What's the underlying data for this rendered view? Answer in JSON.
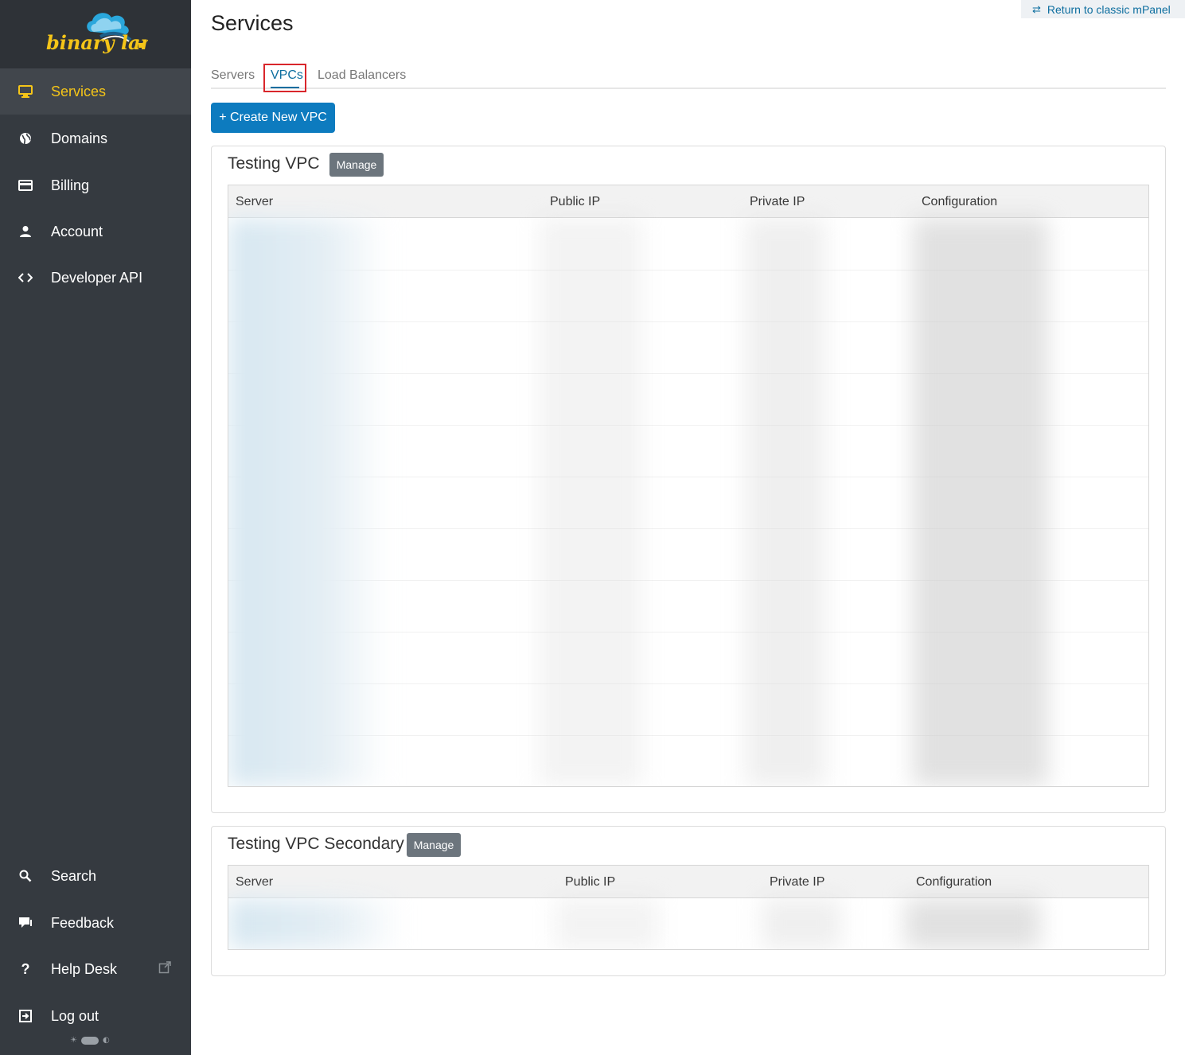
{
  "brand": {
    "logo_text": "binary lane"
  },
  "sidebar": {
    "nav": [
      {
        "label": "Services",
        "icon": "monitor-icon",
        "active": true
      },
      {
        "label": "Domains",
        "icon": "globe-icon",
        "active": false
      },
      {
        "label": "Billing",
        "icon": "credit-card-icon",
        "active": false
      },
      {
        "label": "Account",
        "icon": "user-icon",
        "active": false
      },
      {
        "label": "Developer API",
        "icon": "code-icon",
        "active": false
      }
    ],
    "bottom": [
      {
        "label": "Search",
        "icon": "search-icon"
      },
      {
        "label": "Feedback",
        "icon": "chat-icon"
      },
      {
        "label": "Help Desk",
        "icon": "question-icon",
        "external": true
      },
      {
        "label": "Log out",
        "icon": "logout-icon"
      }
    ]
  },
  "header": {
    "title": "Services",
    "return_link": "Return to classic mPanel"
  },
  "tabs": [
    {
      "label": "Servers",
      "active": false
    },
    {
      "label": "VPCs",
      "active": true
    },
    {
      "label": "Load Balancers",
      "active": false
    }
  ],
  "create_button": "+ Create New VPC",
  "vpcs": [
    {
      "name": "Testing VPC",
      "manage_label": "Manage",
      "columns": [
        "Server",
        "Public IP",
        "Private IP",
        "Configuration"
      ]
    },
    {
      "name": "Testing VPC Secondary",
      "manage_label": "Manage",
      "columns": [
        "Server",
        "Public IP",
        "Private IP",
        "Configuration"
      ]
    }
  ],
  "colors": {
    "sidebar_bg": "#353a40",
    "accent_yellow": "#f5c518",
    "link_blue": "#0d6e9f",
    "button_blue": "#0d7bbf",
    "manage_gray": "#6c757d",
    "highlight_red": "#d9262b"
  }
}
